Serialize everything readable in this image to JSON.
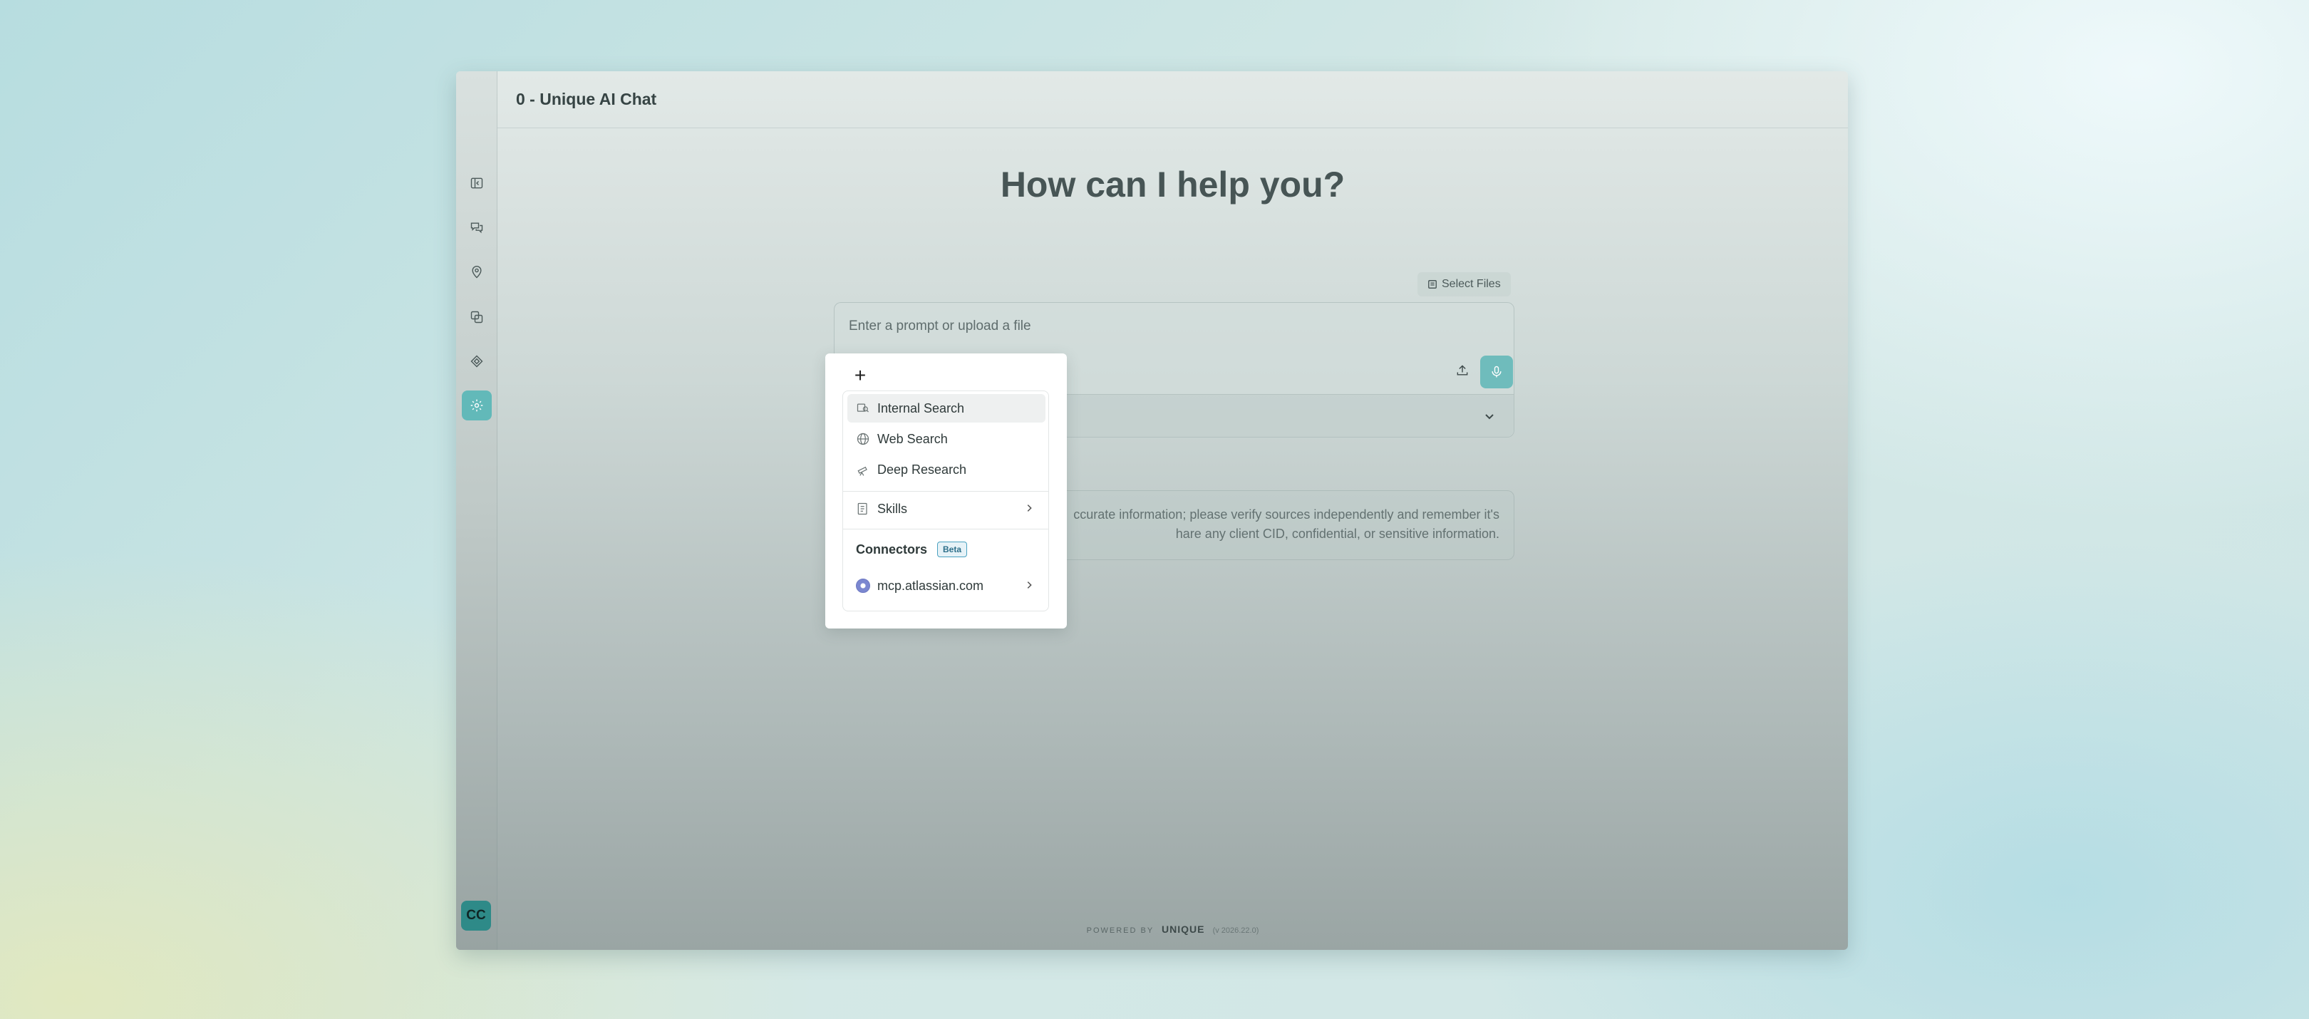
{
  "window": {
    "title": "0 - Unique AI Chat"
  },
  "sidebar": {
    "items": [
      {
        "name": "collapse-sidebar",
        "icon": "sidebar-collapse-icon"
      },
      {
        "name": "chats",
        "icon": "chat-bubbles-icon"
      },
      {
        "name": "explore",
        "icon": "location-pin-icon"
      },
      {
        "name": "spaces",
        "icon": "copy-stack-icon"
      },
      {
        "name": "prompts",
        "icon": "diamond-icon"
      },
      {
        "name": "settings",
        "icon": "gear-icon",
        "active": true
      }
    ],
    "avatar_initials": "CC"
  },
  "main": {
    "heading": "How can I help you?",
    "select_files_label": "Select Files",
    "prompt_placeholder": "Enter a prompt or upload a file",
    "disclaimer": "ccurate information; please verify sources independently and remember it's\nhare any client CID, confidential, or sensitive information."
  },
  "menu": {
    "plus_label": "+",
    "items": [
      {
        "label": "Internal Search",
        "icon": "search-database-icon",
        "selected": true
      },
      {
        "label": "Web Search",
        "icon": "globe-icon"
      },
      {
        "label": "Deep Research",
        "icon": "telescope-icon"
      }
    ],
    "skills_label": "Skills",
    "connectors_label": "Connectors",
    "beta_label": "Beta",
    "connector_items": [
      {
        "label": "mcp.atlassian.com",
        "icon": "connector-icon"
      }
    ]
  },
  "footer": {
    "powered_by": "POWERED BY",
    "brand": "UNIQUE",
    "version": "(v 2026.22.0)"
  },
  "colors": {
    "accent": "#62b9b9",
    "avatar": "#2e8a88"
  }
}
